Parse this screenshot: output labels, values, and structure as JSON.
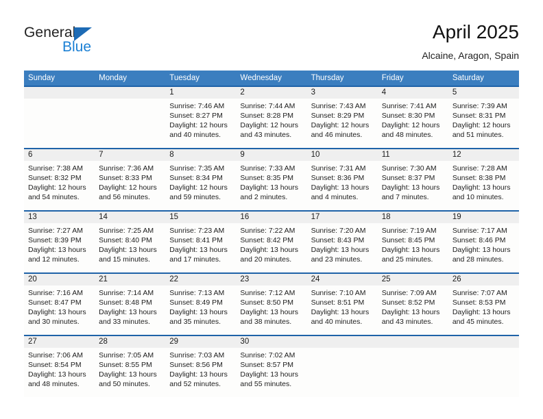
{
  "brand": {
    "name_part1": "General",
    "name_part2": "Blue",
    "logo_icon": "triangle-logo-icon"
  },
  "header": {
    "title": "April 2025",
    "subtitle": "Alcaine, Aragon, Spain"
  },
  "colors": {
    "header_blue": "#3b7ebf",
    "rule_blue": "#1e62a8",
    "date_band": "#efefef",
    "brand_blue": "#1a7fd4"
  },
  "calendar": {
    "day_headers": [
      "Sunday",
      "Monday",
      "Tuesday",
      "Wednesday",
      "Thursday",
      "Friday",
      "Saturday"
    ],
    "weeks": [
      {
        "dates": [
          "",
          "",
          "1",
          "2",
          "3",
          "4",
          "5"
        ],
        "cells": [
          {
            "empty": true,
            "line1": "",
            "line2": "",
            "line3": "",
            "line4": ""
          },
          {
            "empty": true,
            "line1": "",
            "line2": "",
            "line3": "",
            "line4": ""
          },
          {
            "empty": false,
            "line1": "Sunrise: 7:46 AM",
            "line2": "Sunset: 8:27 PM",
            "line3": "Daylight: 12 hours",
            "line4": "and 40 minutes."
          },
          {
            "empty": false,
            "line1": "Sunrise: 7:44 AM",
            "line2": "Sunset: 8:28 PM",
            "line3": "Daylight: 12 hours",
            "line4": "and 43 minutes."
          },
          {
            "empty": false,
            "line1": "Sunrise: 7:43 AM",
            "line2": "Sunset: 8:29 PM",
            "line3": "Daylight: 12 hours",
            "line4": "and 46 minutes."
          },
          {
            "empty": false,
            "line1": "Sunrise: 7:41 AM",
            "line2": "Sunset: 8:30 PM",
            "line3": "Daylight: 12 hours",
            "line4": "and 48 minutes."
          },
          {
            "empty": false,
            "line1": "Sunrise: 7:39 AM",
            "line2": "Sunset: 8:31 PM",
            "line3": "Daylight: 12 hours",
            "line4": "and 51 minutes."
          }
        ]
      },
      {
        "dates": [
          "6",
          "7",
          "8",
          "9",
          "10",
          "11",
          "12"
        ],
        "cells": [
          {
            "empty": false,
            "line1": "Sunrise: 7:38 AM",
            "line2": "Sunset: 8:32 PM",
            "line3": "Daylight: 12 hours",
            "line4": "and 54 minutes."
          },
          {
            "empty": false,
            "line1": "Sunrise: 7:36 AM",
            "line2": "Sunset: 8:33 PM",
            "line3": "Daylight: 12 hours",
            "line4": "and 56 minutes."
          },
          {
            "empty": false,
            "line1": "Sunrise: 7:35 AM",
            "line2": "Sunset: 8:34 PM",
            "line3": "Daylight: 12 hours",
            "line4": "and 59 minutes."
          },
          {
            "empty": false,
            "line1": "Sunrise: 7:33 AM",
            "line2": "Sunset: 8:35 PM",
            "line3": "Daylight: 13 hours",
            "line4": "and 2 minutes."
          },
          {
            "empty": false,
            "line1": "Sunrise: 7:31 AM",
            "line2": "Sunset: 8:36 PM",
            "line3": "Daylight: 13 hours",
            "line4": "and 4 minutes."
          },
          {
            "empty": false,
            "line1": "Sunrise: 7:30 AM",
            "line2": "Sunset: 8:37 PM",
            "line3": "Daylight: 13 hours",
            "line4": "and 7 minutes."
          },
          {
            "empty": false,
            "line1": "Sunrise: 7:28 AM",
            "line2": "Sunset: 8:38 PM",
            "line3": "Daylight: 13 hours",
            "line4": "and 10 minutes."
          }
        ]
      },
      {
        "dates": [
          "13",
          "14",
          "15",
          "16",
          "17",
          "18",
          "19"
        ],
        "cells": [
          {
            "empty": false,
            "line1": "Sunrise: 7:27 AM",
            "line2": "Sunset: 8:39 PM",
            "line3": "Daylight: 13 hours",
            "line4": "and 12 minutes."
          },
          {
            "empty": false,
            "line1": "Sunrise: 7:25 AM",
            "line2": "Sunset: 8:40 PM",
            "line3": "Daylight: 13 hours",
            "line4": "and 15 minutes."
          },
          {
            "empty": false,
            "line1": "Sunrise: 7:23 AM",
            "line2": "Sunset: 8:41 PM",
            "line3": "Daylight: 13 hours",
            "line4": "and 17 minutes."
          },
          {
            "empty": false,
            "line1": "Sunrise: 7:22 AM",
            "line2": "Sunset: 8:42 PM",
            "line3": "Daylight: 13 hours",
            "line4": "and 20 minutes."
          },
          {
            "empty": false,
            "line1": "Sunrise: 7:20 AM",
            "line2": "Sunset: 8:43 PM",
            "line3": "Daylight: 13 hours",
            "line4": "and 23 minutes."
          },
          {
            "empty": false,
            "line1": "Sunrise: 7:19 AM",
            "line2": "Sunset: 8:45 PM",
            "line3": "Daylight: 13 hours",
            "line4": "and 25 minutes."
          },
          {
            "empty": false,
            "line1": "Sunrise: 7:17 AM",
            "line2": "Sunset: 8:46 PM",
            "line3": "Daylight: 13 hours",
            "line4": "and 28 minutes."
          }
        ]
      },
      {
        "dates": [
          "20",
          "21",
          "22",
          "23",
          "24",
          "25",
          "26"
        ],
        "cells": [
          {
            "empty": false,
            "line1": "Sunrise: 7:16 AM",
            "line2": "Sunset: 8:47 PM",
            "line3": "Daylight: 13 hours",
            "line4": "and 30 minutes."
          },
          {
            "empty": false,
            "line1": "Sunrise: 7:14 AM",
            "line2": "Sunset: 8:48 PM",
            "line3": "Daylight: 13 hours",
            "line4": "and 33 minutes."
          },
          {
            "empty": false,
            "line1": "Sunrise: 7:13 AM",
            "line2": "Sunset: 8:49 PM",
            "line3": "Daylight: 13 hours",
            "line4": "and 35 minutes."
          },
          {
            "empty": false,
            "line1": "Sunrise: 7:12 AM",
            "line2": "Sunset: 8:50 PM",
            "line3": "Daylight: 13 hours",
            "line4": "and 38 minutes."
          },
          {
            "empty": false,
            "line1": "Sunrise: 7:10 AM",
            "line2": "Sunset: 8:51 PM",
            "line3": "Daylight: 13 hours",
            "line4": "and 40 minutes."
          },
          {
            "empty": false,
            "line1": "Sunrise: 7:09 AM",
            "line2": "Sunset: 8:52 PM",
            "line3": "Daylight: 13 hours",
            "line4": "and 43 minutes."
          },
          {
            "empty": false,
            "line1": "Sunrise: 7:07 AM",
            "line2": "Sunset: 8:53 PM",
            "line3": "Daylight: 13 hours",
            "line4": "and 45 minutes."
          }
        ]
      },
      {
        "dates": [
          "27",
          "28",
          "29",
          "30",
          "",
          "",
          ""
        ],
        "cells": [
          {
            "empty": false,
            "line1": "Sunrise: 7:06 AM",
            "line2": "Sunset: 8:54 PM",
            "line3": "Daylight: 13 hours",
            "line4": "and 48 minutes."
          },
          {
            "empty": false,
            "line1": "Sunrise: 7:05 AM",
            "line2": "Sunset: 8:55 PM",
            "line3": "Daylight: 13 hours",
            "line4": "and 50 minutes."
          },
          {
            "empty": false,
            "line1": "Sunrise: 7:03 AM",
            "line2": "Sunset: 8:56 PM",
            "line3": "Daylight: 13 hours",
            "line4": "and 52 minutes."
          },
          {
            "empty": false,
            "line1": "Sunrise: 7:02 AM",
            "line2": "Sunset: 8:57 PM",
            "line3": "Daylight: 13 hours",
            "line4": "and 55 minutes."
          },
          {
            "empty": true,
            "line1": "",
            "line2": "",
            "line3": "",
            "line4": ""
          },
          {
            "empty": true,
            "line1": "",
            "line2": "",
            "line3": "",
            "line4": ""
          },
          {
            "empty": true,
            "line1": "",
            "line2": "",
            "line3": "",
            "line4": ""
          }
        ]
      }
    ]
  }
}
